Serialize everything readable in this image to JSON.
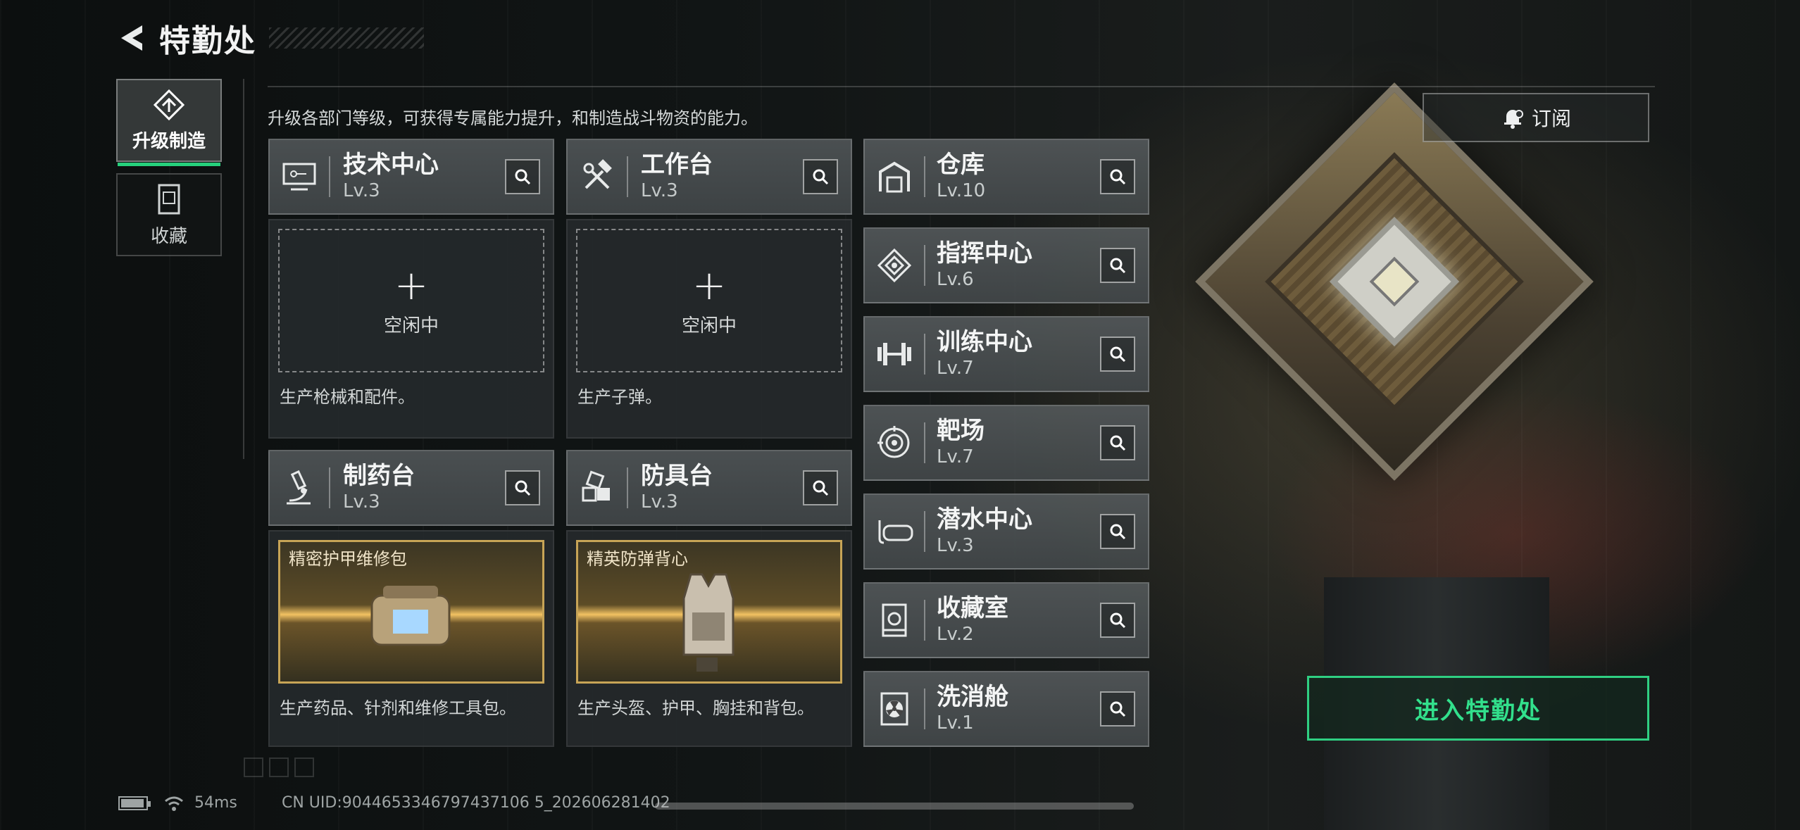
{
  "header": {
    "title": "特勤处"
  },
  "side_tabs": [
    {
      "label": "升级制造",
      "active": true
    },
    {
      "label": "收藏",
      "active": false
    }
  ],
  "description": "升级各部门等级，可获得专属能力提升，和制造战斗物资的能力。",
  "grid_cards": [
    {
      "name": "技术中心",
      "level": "Lv.3",
      "icon": "computer-icon",
      "state": "空闲中",
      "desc": "生产枪械和配件。"
    },
    {
      "name": "工作台",
      "level": "Lv.3",
      "icon": "hammer-wrench-icon",
      "state": "空闲中",
      "desc": "生产子弹。"
    },
    {
      "name": "制药台",
      "level": "Lv.3",
      "icon": "microscope-icon",
      "item": "精密护甲维修包",
      "desc": "生产药品、针剂和维修工具包。"
    },
    {
      "name": "防具台",
      "level": "Lv.3",
      "icon": "cubes-icon",
      "item": "精英防弹背心",
      "desc": "生产头盔、护甲、胸挂和背包。"
    }
  ],
  "list_items": [
    {
      "name": "仓库",
      "level": "Lv.10",
      "icon": "warehouse-icon"
    },
    {
      "name": "指挥中心",
      "level": "Lv.6",
      "icon": "command-icon"
    },
    {
      "name": "训练中心",
      "level": "Lv.7",
      "icon": "dumbbell-icon"
    },
    {
      "name": "靶场",
      "level": "Lv.7",
      "icon": "target-icon"
    },
    {
      "name": "潜水中心",
      "level": "Lv.3",
      "icon": "diving-mask-icon"
    },
    {
      "name": "收藏室",
      "level": "Lv.2",
      "icon": "collection-icon"
    },
    {
      "name": "洗消舱",
      "level": "Lv.1",
      "icon": "radiation-icon"
    }
  ],
  "subscribe_label": "订阅",
  "enter_label": "进入特勤处",
  "status": {
    "ping": "54ms",
    "uid": "CN UID:9044653346797437106 5_202606281402"
  },
  "colors": {
    "accent": "#2fcf82",
    "gold": "#c7a456"
  }
}
